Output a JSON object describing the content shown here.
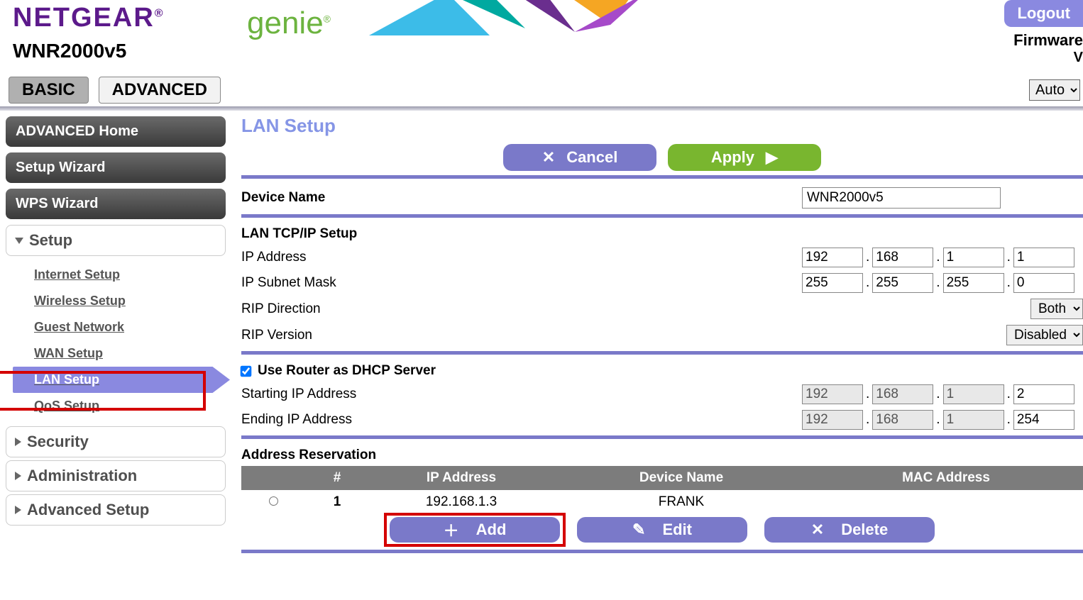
{
  "brand": {
    "netgear": "NETGEAR",
    "genie": "genie",
    "reg": "®"
  },
  "model": "WNR2000v5",
  "header": {
    "logout": "Logout",
    "firmware": "Firmware",
    "firmware_sub": "V"
  },
  "tabs": {
    "basic": "BASIC",
    "advanced": "ADVANCED",
    "auto": "Auto"
  },
  "sidebar": {
    "adv_home": "ADVANCED Home",
    "setup_wiz": "Setup Wizard",
    "wps": "WPS Wizard",
    "sections": {
      "setup": "Setup",
      "security": "Security",
      "administration": "Administration",
      "advanced_setup": "Advanced Setup"
    },
    "setup_items": {
      "internet": "Internet Setup",
      "wireless": "Wireless Setup",
      "guest": "Guest Network",
      "wan": "WAN Setup",
      "lan": "LAN Setup",
      "qos": "QoS Setup"
    }
  },
  "page": {
    "title": "LAN Setup",
    "cancel": "Cancel",
    "apply": "Apply",
    "device_name_lbl": "Device Name",
    "device_name_val": "WNR2000v5",
    "tcpip_hdr": "LAN TCP/IP Setup",
    "ip_lbl": "IP Address",
    "ip": [
      "192",
      "168",
      "1",
      "1"
    ],
    "mask_lbl": "IP Subnet Mask",
    "mask": [
      "255",
      "255",
      "255",
      "0"
    ],
    "rip_dir_lbl": "RIP Direction",
    "rip_dir_val": "Both",
    "rip_ver_lbl": "RIP Version",
    "rip_ver_val": "Disabled",
    "dhcp_chk_lbl": "Use Router as DHCP Server",
    "start_lbl": "Starting IP Address",
    "start": [
      "192",
      "168",
      "1",
      "2"
    ],
    "end_lbl": "Ending IP Address",
    "end": [
      "192",
      "168",
      "1",
      "254"
    ],
    "res_hdr": "Address Reservation",
    "tbl": {
      "num": "#",
      "ip": "IP Address",
      "dn": "Device Name",
      "mac": "MAC Address"
    },
    "rows": [
      {
        "n": "1",
        "ip": "192.168.1.3",
        "dn": "FRANK",
        "mac": ""
      }
    ],
    "actions": {
      "add": "Add",
      "edit": "Edit",
      "delete": "Delete"
    }
  }
}
